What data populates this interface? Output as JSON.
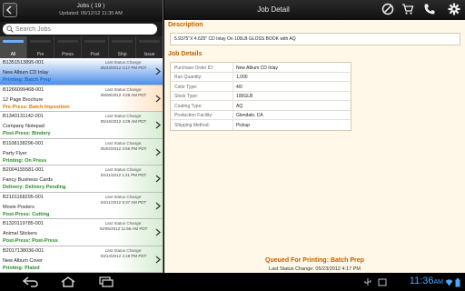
{
  "left_header": {
    "title": "Jobs ( 19 )",
    "updated": "Updated: 06/12/12 11:35 AM"
  },
  "search": {
    "placeholder": "Search Jobs",
    "value": ""
  },
  "tabs": [
    {
      "label": "All",
      "active": true
    },
    {
      "label": "Pre",
      "active": false
    },
    {
      "label": "Press",
      "active": false
    },
    {
      "label": "Post",
      "active": false
    },
    {
      "label": "Ship",
      "active": false
    },
    {
      "label": "Issue",
      "active": false
    }
  ],
  "jobs": [
    {
      "number": "B1351513895-001",
      "last_status_label": "Last Status Change:",
      "last_status_date": "05/23/2012 4:17 PM PDT",
      "name": "New Album CD Inlay",
      "status": "Printing: Batch Prep",
      "state": "selected"
    },
    {
      "number": "B1266099468-001",
      "last_status_label": "Last Status Change:",
      "last_status_date": "06/06/2012 4:29 AM PDT",
      "name": "12 Page Brochure",
      "status": "Pre-Press: Batch Imposition",
      "state": "pre"
    },
    {
      "number": "B1340131142-001",
      "last_status_label": "Last Status Change:",
      "last_status_date": "05/16/2012 4:29 AM PDT",
      "name": "Company Notepad",
      "status": "Post-Press: Bindery",
      "state": "post"
    },
    {
      "number": "B1108138296-001",
      "last_status_label": "Last Status Change:",
      "last_status_date": "05/02/2012 3:55 PM PDT",
      "name": "Party Flyer",
      "status": "Printing: On Press",
      "state": "post"
    },
    {
      "number": "B2004155581-001",
      "last_status_label": "Last Status Change:",
      "last_status_date": "04/11/2012 1:41 PM PDT",
      "name": "Fancy Business Cards",
      "status": "Delivery: Delivery Pending",
      "state": "post"
    },
    {
      "number": "B2101168295-001",
      "last_status_label": "Last Status Change:",
      "last_status_date": "04/11/2012 9:37 AM PDT",
      "name": "Movie Posters",
      "status": "Post-Press: Cutting",
      "state": "post"
    },
    {
      "number": "B1320119785-001",
      "last_status_label": "Last Status Change:",
      "last_status_date": "04/05/2012 11:56 AM PDT",
      "name": "Animal Stickers",
      "status": "Post-Press: Post-Press",
      "state": "post"
    },
    {
      "number": "B2017138036-001",
      "last_status_label": "Last Status Change:",
      "last_status_date": "03/14/2012 4:19 PM PDT",
      "name": "New Album Cover",
      "status": "Printing: Plated",
      "state": "post"
    }
  ],
  "detail": {
    "title": "Job Detail",
    "description_heading": "Description",
    "description": "5.9375\"X 4.625\" CD Inlay On 100LB GLOSS BOOK with AQ",
    "details_heading": "Job Details",
    "rows": [
      {
        "label": "Purchase Order ID:",
        "value": "New Album CD Inlay"
      },
      {
        "label": "Run Quantity:",
        "value": "1,000"
      },
      {
        "label": "Color Type:",
        "value": "4/0"
      },
      {
        "label": "Stock Type:",
        "value": "100GLB"
      },
      {
        "label": "Coating Type:",
        "value": "AQ"
      },
      {
        "label": "Production Facility:",
        "value": "Glendale, CA"
      },
      {
        "label": "Shipping Method:",
        "value": "Pickup"
      }
    ],
    "queued": "Queued For Printing: Batch Prep",
    "last_change": "Last Status Change: 05/23/2012 4:17 PM"
  },
  "system_bar": {
    "time": "11:36",
    "am_pm": "AM",
    "accent": "#4aa8ff"
  },
  "icons": {
    "header": [
      "cancel-icon",
      "cart-icon",
      "phone-icon",
      "settings-icon"
    ],
    "system": [
      "back-icon",
      "home-icon",
      "recent-apps-icon",
      "usb-icon",
      "notification-icon",
      "wifi-icon",
      "battery-icon"
    ]
  },
  "colors": {
    "selected_row": "#4d8ee8",
    "section_heading": "#c06000",
    "pre_status": "#e07b00",
    "post_status": "#2a8a2a"
  }
}
